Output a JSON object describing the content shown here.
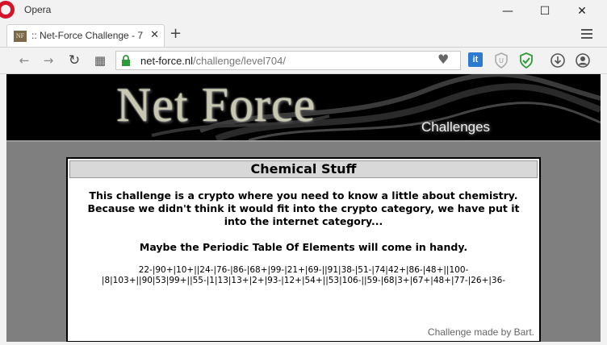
{
  "window": {
    "app_title": "Opera",
    "minimize": "—",
    "maximize": "☐",
    "close": "✕"
  },
  "tab": {
    "favicon_text": "NF",
    "title": ":: Net-Force Challenge - 7",
    "close": "✕",
    "new_tab": "+"
  },
  "toolbar": {
    "url_host": "net-force.nl",
    "url_path": "/challenge/level704/",
    "back": "←",
    "forward": "→",
    "reload": "↻",
    "speed_dial": "▦",
    "heart": "♥",
    "ext_it": "it"
  },
  "banner": {
    "title": "Net Force",
    "subtitle": "Challenges"
  },
  "panel": {
    "title": "Chemical Stuff",
    "paragraph1": "This challenge is a crypto where you need to know a little about chemistry. Because we didn't think it would fit into the crypto category, we have put it into the internet category...",
    "paragraph2": "Maybe the Periodic Table Of Elements will come in handy.",
    "code_line1": "22-|90+|10+||24-|76-|86-|68+|99-|21+|69-||91|38-|51-|74|42+|86-|48+||100-",
    "code_line2": "|8|103+||90|53|99+||55-|1|13|13+|2+|93-|12+|54+||53|106-||59-|68|3+|67+|48+|77-|26+|36-",
    "credit": "Challenge made by Bart."
  },
  "colors": {
    "page_bg": "#7f7f7f",
    "panel_bg": "#ffffff",
    "header_bg": "#d8d8d8",
    "opera_red": "#d4142b"
  }
}
